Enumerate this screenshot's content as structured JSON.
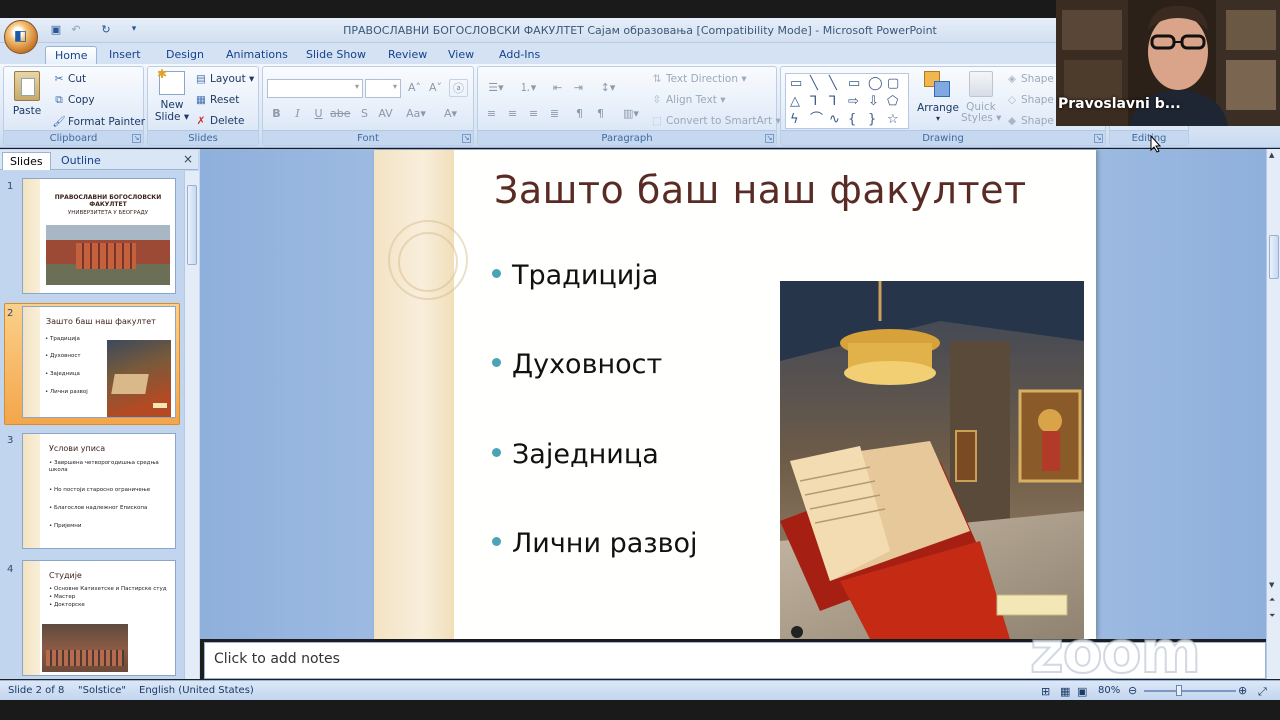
{
  "window": {
    "title": "ПРАВОСЛАВНИ БОГОСЛОВСКИ ФАКУЛТЕТ Сајам образовања [Compatibility Mode] - Microsoft PowerPoint"
  },
  "tabs": [
    "Home",
    "Insert",
    "Design",
    "Animations",
    "Slide Show",
    "Review",
    "View",
    "Add-Ins"
  ],
  "ribbon": {
    "clipboard": {
      "label": "Clipboard",
      "paste": "Paste",
      "cut": "Cut",
      "copy": "Copy",
      "format_painter": "Format Painter"
    },
    "slides": {
      "label": "Slides",
      "new_slide_1": "New",
      "new_slide_2": "Slide",
      "layout": "Layout",
      "reset": "Reset",
      "delete": "Delete"
    },
    "font": {
      "label": "Font"
    },
    "paragraph": {
      "label": "Paragraph",
      "text_direction": "Text Direction",
      "align_text": "Align Text",
      "convert_smartart": "Convert to SmartArt"
    },
    "drawing": {
      "label": "Drawing",
      "arrange": "Arrange",
      "quick_styles_1": "Quick",
      "quick_styles_2": "Styles",
      "shape_1": "Shape F",
      "shape_2": "Shape O",
      "shape_3": "Shape E"
    },
    "editing": {
      "label": "Editing"
    }
  },
  "pane": {
    "tab_slides": "Slides",
    "tab_outline": "Outline",
    "close": "×"
  },
  "thumbnails": [
    {
      "num": "1",
      "title_1": "ПРАВОСЛАВНИ БОГОСЛОВСКИ",
      "title_2": "ФАКУЛТЕТ",
      "subtitle": "УНИВЕРЗИТЕТА У БЕОГРАДУ"
    },
    {
      "num": "2",
      "title": "Зашто баш наш факултет",
      "bullets": [
        "Традиција",
        "Духовност",
        "Заједница",
        "Лични развој"
      ]
    },
    {
      "num": "3",
      "title": "Услови уписа",
      "bullets": [
        "Завршена четворогодишња средња школа",
        "Но постоји старосно ограничење",
        "Благослов надлежног Епископа",
        "Пријемни"
      ]
    },
    {
      "num": "4",
      "title": "Студије",
      "bullets": [
        "Основне Катихетске и Пастирске студ",
        "Мастер",
        "Докторске"
      ]
    }
  ],
  "slide": {
    "title": "Зашто баш наш факултет",
    "bullets": [
      "Традиција",
      "Духовност",
      "Заједница",
      "Лични развој"
    ]
  },
  "notes": {
    "placeholder": "Click to add notes"
  },
  "status": {
    "slide": "Slide 2 of 8",
    "theme": "\"Solstice\"",
    "language": "English (United States)",
    "zoom": "80%"
  },
  "video": {
    "name": "Pravoslavni b..."
  },
  "watermark": "zoom",
  "colors": {
    "accent": "#f2b45b",
    "title": "#5a2b24",
    "bullet": "#4aa3b6"
  }
}
